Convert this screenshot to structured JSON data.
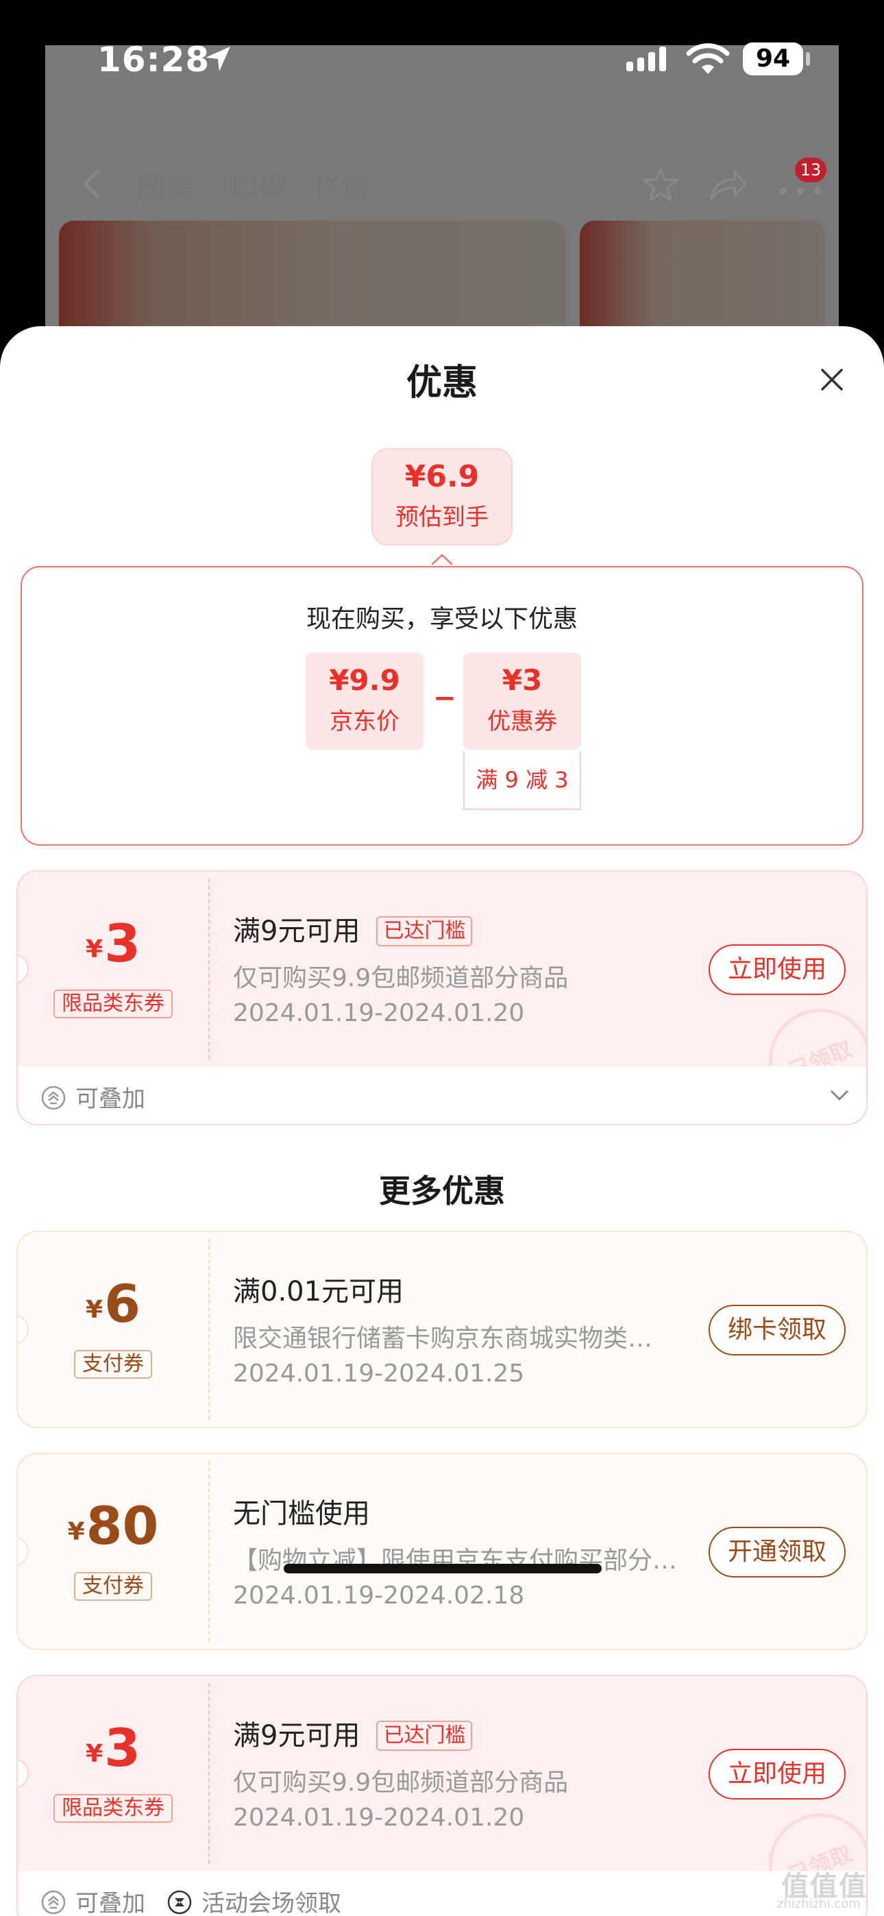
{
  "status": {
    "time": "16:28",
    "battery": "94"
  },
  "bg": {
    "tabs": [
      "图集",
      "口碑",
      "详情"
    ],
    "badge": "13"
  },
  "sheet": {
    "title": "优惠"
  },
  "estimate": {
    "price": "¥6.9",
    "label": "预估到手"
  },
  "breakdown": {
    "heading": "现在购买，享受以下优惠",
    "jd_price": "¥9.9",
    "jd_label": "京东价",
    "minus": "−",
    "coupon_value": "¥3",
    "coupon_label": "优惠券",
    "coupon_cond": "满 9 减 3"
  },
  "coupons": [
    {
      "yen": "¥",
      "amount": "3",
      "type": "限品类东券",
      "title": "满9元可用",
      "tag": "已达门槛",
      "desc": "仅可购买9.9包邮频道部分商品",
      "date": "2024.01.19-2024.01.20",
      "button": "立即使用",
      "stamp": "已领取"
    },
    {
      "yen": "¥",
      "amount": "6",
      "type": "支付券",
      "title": "满0.01元可用",
      "tag": "",
      "desc": "限交通银行储蓄卡购京东商城实物类…",
      "date": "2024.01.19-2024.01.25",
      "button": "绑卡领取",
      "stamp": ""
    },
    {
      "yen": "¥",
      "amount": "80",
      "type": "支付券",
      "title": "无门槛使用",
      "tag": "",
      "desc": "【购物立减】限使用京东支付购买部分…",
      "date": "2024.01.19-2024.02.18",
      "button": "开通领取",
      "stamp": ""
    },
    {
      "yen": "¥",
      "amount": "3",
      "type": "限品类东券",
      "title": "满9元可用",
      "tag": "已达门槛",
      "desc": "仅可购买9.9包邮频道部分商品",
      "date": "2024.01.19-2024.01.20",
      "button": "立即使用",
      "stamp": "已领取"
    }
  ],
  "footer1": {
    "stackable": "可叠加"
  },
  "footer2": {
    "stackable": "可叠加",
    "activity": "活动会场领取"
  },
  "more_title": "更多优惠",
  "watermark": {
    "main": "值值值",
    "sub": "zhizhizhi.com"
  }
}
